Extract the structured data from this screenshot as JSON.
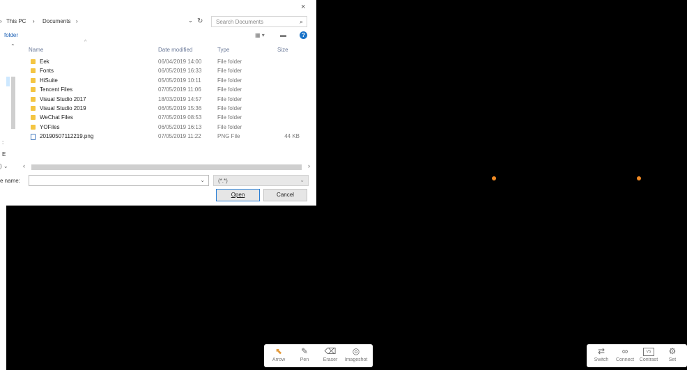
{
  "dialog": {
    "close_glyph": "×",
    "breadcrumb": {
      "sep1": "›",
      "this_pc": "This PC",
      "sep2": "›",
      "documents": "Documents",
      "sep3": "›"
    },
    "address_dropdown_glyph": "⌄",
    "refresh_glyph": "↻",
    "search_placeholder": "Search Documents",
    "search_icon": "search-icon",
    "toolbar_new_folder": "folder",
    "view_glyph": "▦ ▾",
    "preview_glyph": "▬",
    "help_glyph": "?",
    "columns": {
      "name": "Name",
      "date": "Date modified",
      "type": "Type",
      "size": "Size"
    },
    "files": [
      {
        "name": "Eek",
        "date": "06/04/2019 14:00",
        "type": "File folder",
        "size": "",
        "icon": "folder-icon"
      },
      {
        "name": "Fonts",
        "date": "06/05/2019 16:33",
        "type": "File folder",
        "size": "",
        "icon": "folder-icon"
      },
      {
        "name": "HiSuite",
        "date": "05/05/2019 10:11",
        "type": "File folder",
        "size": "",
        "icon": "folder-icon"
      },
      {
        "name": "Tencent Files",
        "date": "07/05/2019 11:06",
        "type": "File folder",
        "size": "",
        "icon": "folder-icon"
      },
      {
        "name": "Visual Studio 2017",
        "date": "18/03/2019 14:57",
        "type": "File folder",
        "size": "",
        "icon": "folder-icon"
      },
      {
        "name": "Visual Studio 2019",
        "date": "06/05/2019 15:36",
        "type": "File folder",
        "size": "",
        "icon": "folder-icon"
      },
      {
        "name": "WeChat Files",
        "date": "07/05/2019 08:53",
        "type": "File folder",
        "size": "",
        "icon": "folder-icon"
      },
      {
        "name": "YOFiles",
        "date": "06/05/2019 16:13",
        "type": "File folder",
        "size": "",
        "icon": "folder-icon"
      },
      {
        "name": "20190507112219.png",
        "date": "07/05/2019 11:22",
        "type": "PNG File",
        "size": "44 KB",
        "icon": "png-file-icon"
      }
    ],
    "nav_labels": {
      "a": ":",
      "b": "E",
      "c": ") ⌄"
    },
    "filename_label": "e name:",
    "filename_value": "",
    "filetype_value": "(*.*)",
    "open_label": "Open",
    "cancel_label": "Cancel"
  },
  "toolbar_left": {
    "tools": [
      {
        "label": "Arrow",
        "icon": "arrow-cursor-icon",
        "glyph": "⬉"
      },
      {
        "label": "Pen",
        "icon": "pen-icon",
        "glyph": "✎"
      },
      {
        "label": "Eraser",
        "icon": "eraser-icon",
        "glyph": "⌫"
      },
      {
        "label": "Imageshot",
        "icon": "camera-icon",
        "glyph": "◎"
      }
    ]
  },
  "toolbar_right": {
    "tools": [
      {
        "label": "Switch",
        "icon": "switch-icon",
        "glyph": "⇄"
      },
      {
        "label": "Connect",
        "icon": "link-icon",
        "glyph": "∞"
      },
      {
        "label": "Contrast",
        "icon": "vs-compare-icon",
        "glyph": "VS"
      },
      {
        "label": "Set",
        "icon": "settings-gear-icon",
        "glyph": "⚙"
      }
    ]
  },
  "colors": {
    "marker": "#f08a24",
    "background": "#000000",
    "accent": "#1a73c8"
  }
}
